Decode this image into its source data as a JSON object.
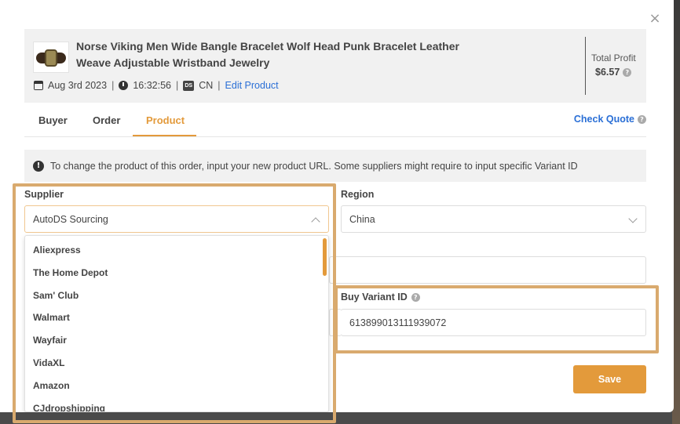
{
  "modal": {
    "close_symbol": "×"
  },
  "product": {
    "title": "Norse Viking Men Wide Bangle Bracelet Wolf Head Punk Bracelet Leather Weave Adjustable Wristband Jewelry",
    "date": "Aug 3rd 2023",
    "time": "16:32:56",
    "ds_badge": "DS",
    "country": "CN",
    "edit_link": "Edit Product",
    "total_profit_label": "Total Profit",
    "total_profit_value": "$6.57"
  },
  "tabs": [
    {
      "label": "Buyer"
    },
    {
      "label": "Order"
    },
    {
      "label": "Product",
      "active": true
    }
  ],
  "check_quote": "Check Quote",
  "info_message": "To change the product of this order, input your new product URL. Some suppliers might require to input specific Variant ID",
  "supplier": {
    "label": "Supplier",
    "selected": "AutoDS Sourcing",
    "options": [
      "Aliexpress",
      "The Home Depot",
      "Sam' Club",
      "Walmart",
      "Wayfair",
      "VidaXL",
      "Amazon",
      "CJdropshipping"
    ]
  },
  "region": {
    "label": "Region",
    "selected": "China"
  },
  "product_url": {
    "value": ""
  },
  "buy_variant": {
    "label": "Buy Variant ID",
    "value": "613899013111939072"
  },
  "save_label": "Save",
  "colors": {
    "accent": "#e39a3b",
    "link": "#2a6fd6",
    "highlight": "#d9aa6e"
  }
}
